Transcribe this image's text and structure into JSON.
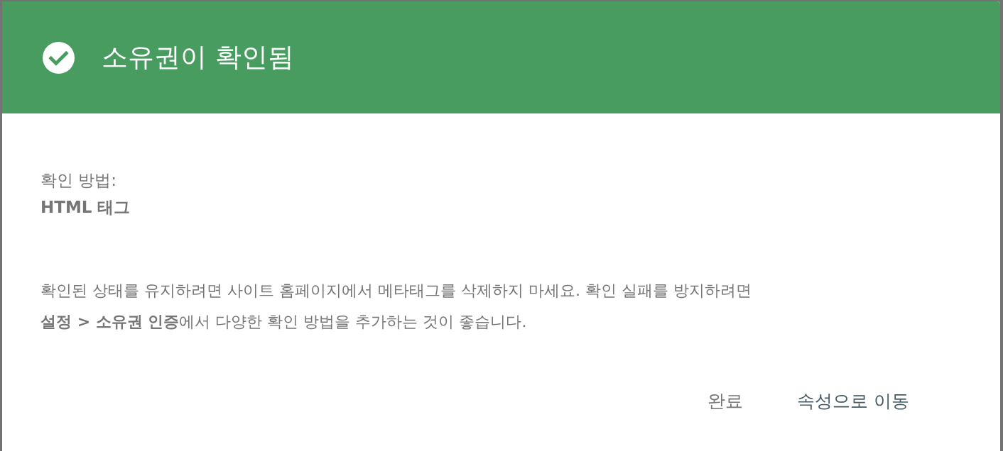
{
  "dialog": {
    "header": {
      "title": "소유권이 확인됨"
    },
    "method": {
      "label": "확인 방법:",
      "value": "HTML 태그"
    },
    "message": "확인된 상태를 유지하려면 사이트 홈페이지에서 메타태그를 삭제하지 마세요. 확인 실패를 방지하려면 **설정 > 소유권 인증**에서 다양한 확인 방법을 추가하는 것이 좋습니다.",
    "buttons": [
      {
        "label": "완료",
        "kind": "secondary"
      },
      {
        "label": "속성으로 이동",
        "kind": "primary"
      }
    ]
  }
}
